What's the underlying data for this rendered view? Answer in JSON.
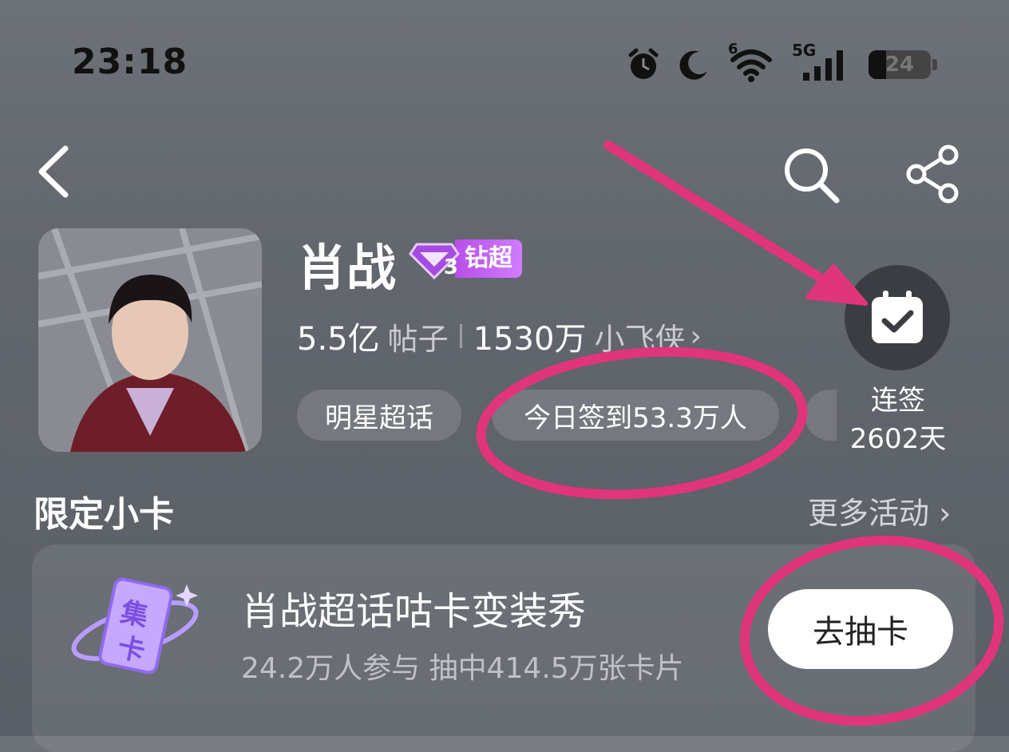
{
  "status_bar": {
    "time": "23:18",
    "signal_label": "5G",
    "wifi_label": "6",
    "battery_level": "24",
    "icons": [
      "alarm-icon",
      "moon-icon",
      "wifi-icon",
      "cellular-signal-icon",
      "battery-icon"
    ]
  },
  "nav": {
    "back_icon": "chevron-left-icon",
    "search_icon": "search-icon",
    "share_icon": "share-icon"
  },
  "topic": {
    "name": "肖战",
    "badge_level": "3",
    "badge_label": "钻超",
    "posts_count": "5.5亿",
    "posts_unit": "帖子",
    "fans_count": "1530万",
    "fans_unit": "小飞侠",
    "fans_chevron": "›",
    "tags": [
      "明星超话",
      "今日签到53.3万人"
    ]
  },
  "checkin": {
    "label_line1": "连签",
    "label_line2": "2602天"
  },
  "section": {
    "title": "限定小卡",
    "more_label": "更多活动 ›"
  },
  "card": {
    "icon_text_top": "集",
    "icon_text_bottom": "卡",
    "title": "肖战超话咕卡变装秀",
    "subtitle": "24.2万人参与 抽中414.5万张卡片",
    "button_label": "去抽卡"
  },
  "colors": {
    "annotation": "#e0357a",
    "badge_gradient_start": "#b84fe8",
    "badge_gradient_end": "#d07cff"
  }
}
